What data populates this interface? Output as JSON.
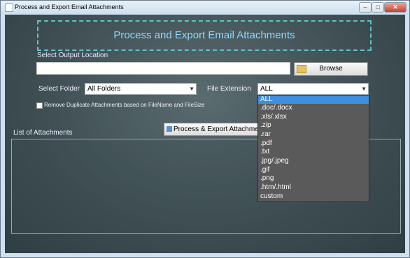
{
  "window": {
    "title": "Process and Export Email Attachments"
  },
  "header": {
    "title": "Process and Export Email Attachments"
  },
  "output": {
    "label": "Select Output Location",
    "value": "",
    "browse_label": "Browse"
  },
  "folder": {
    "label": "Select Folder",
    "selected": "All Folders"
  },
  "extension": {
    "label": "File Extension",
    "selected": "ALL",
    "options": [
      "ALL",
      ".doc/.docx",
      ".xls/.xlsx",
      ".zip",
      ".rar",
      ".pdf",
      ".txt",
      ".jpg/.jpeg",
      ".gif",
      ".png",
      ".htm/.html",
      "custom"
    ]
  },
  "duplicates": {
    "label": "Remove Duplicate Attachments based  on FileName and FileSize",
    "checked": false
  },
  "actions": {
    "export_label": "Process & Export Attachments"
  },
  "list": {
    "label": "List of Attachments"
  }
}
